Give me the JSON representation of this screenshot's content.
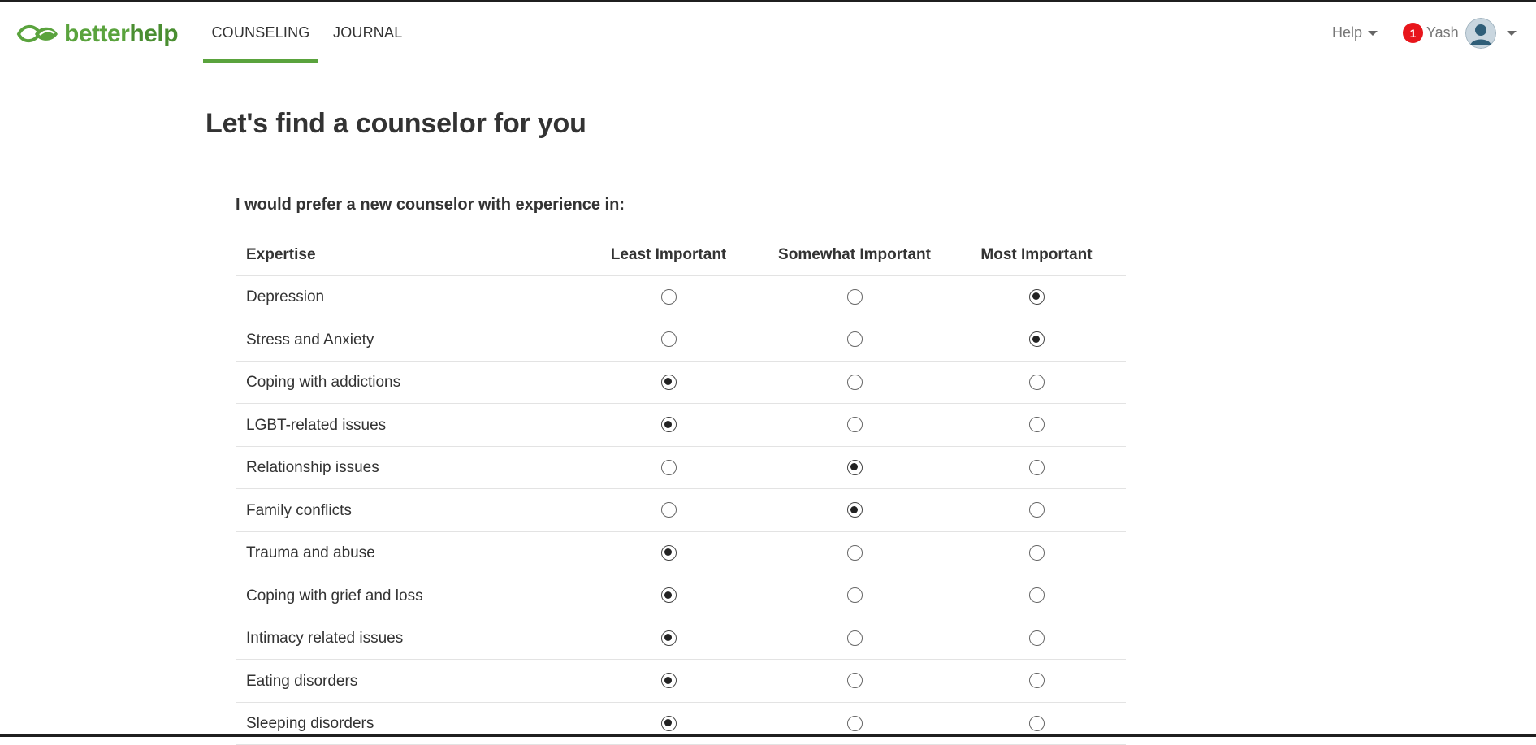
{
  "brand": {
    "logo_text_1": "better",
    "logo_text_2": "help",
    "accent": "#5aa33d"
  },
  "nav": {
    "tabs": [
      {
        "label": "COUNSELING",
        "active": true
      },
      {
        "label": "JOURNAL",
        "active": false
      }
    ],
    "help_label": "Help",
    "user": {
      "name": "Yash",
      "notification_count": "1"
    }
  },
  "main": {
    "title": "Let's find a counselor for you",
    "prompt": "I would prefer a new counselor with experience in:",
    "table": {
      "headers": [
        "Expertise",
        "Least Important",
        "Somewhat Important",
        "Most Important"
      ],
      "rows": [
        {
          "label": "Depression",
          "selected": "Most Important"
        },
        {
          "label": "Stress and Anxiety",
          "selected": "Most Important"
        },
        {
          "label": "Coping with addictions",
          "selected": "Least Important"
        },
        {
          "label": "LGBT-related issues",
          "selected": "Least Important"
        },
        {
          "label": "Relationship issues",
          "selected": "Somewhat Important"
        },
        {
          "label": "Family conflicts",
          "selected": "Somewhat Important"
        },
        {
          "label": "Trauma and abuse",
          "selected": "Least Important"
        },
        {
          "label": "Coping with grief and loss",
          "selected": "Least Important"
        },
        {
          "label": "Intimacy related issues",
          "selected": "Least Important"
        },
        {
          "label": "Eating disorders",
          "selected": "Least Important"
        },
        {
          "label": "Sleeping disorders",
          "selected": "Least Important"
        }
      ]
    }
  }
}
